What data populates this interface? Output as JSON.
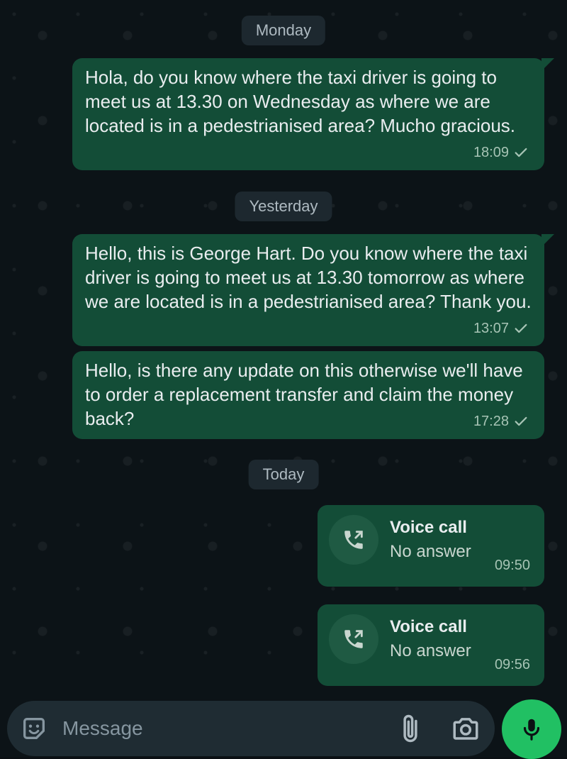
{
  "date_separators": {
    "monday": "Monday",
    "yesterday": "Yesterday",
    "today": "Today"
  },
  "messages": [
    {
      "text": "Hola, do you know where the taxi driver is going to meet us at 13.30 on Wednesday as where we are located is in a pedestrianised area? Mucho gracious.",
      "time": "18:09"
    },
    {
      "text": "Hello, this is George Hart. Do you know where the taxi driver is going to meet us at 13.30 tomorrow as where we are located is in a pedestrianised area? Thank you.",
      "time": "13:07"
    },
    {
      "text": "Hello, is there any update on this otherwise we'll have to order a replacement transfer and claim the money back?",
      "time": "17:28"
    }
  ],
  "calls": [
    {
      "title": "Voice call",
      "status": "No answer",
      "time": "09:50"
    },
    {
      "title": "Voice call",
      "status": "No answer",
      "time": "09:56"
    }
  ],
  "composer": {
    "placeholder": "Message"
  },
  "icons": {
    "sticker": "sticker-icon",
    "attach": "paperclip-icon",
    "camera": "camera-icon",
    "mic": "microphone-icon",
    "call": "outgoing-call-icon",
    "read": "check-icon"
  },
  "colors": {
    "bubble": "#134d37",
    "background": "#0c1317",
    "accent": "#21c063"
  }
}
